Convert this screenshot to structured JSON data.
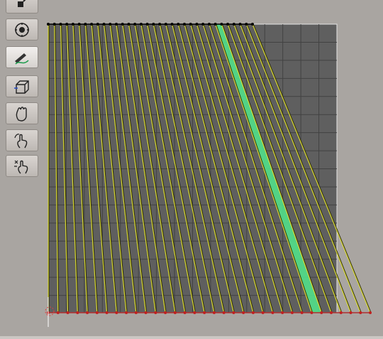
{
  "toolbar": {
    "tools": [
      {
        "icon": "viewport-toggle-icon",
        "active": false
      },
      {
        "icon": "navigation-wheel-icon",
        "active": false
      },
      {
        "icon": "draw-curve-icon",
        "active": true
      },
      {
        "icon": "box-select-icon",
        "active": false
      },
      {
        "icon": "pan-hand-icon",
        "active": false
      },
      {
        "icon": "rotate-hand-icon",
        "active": false
      },
      {
        "icon": "zoom-hand-icon",
        "active": false
      }
    ]
  },
  "scene": {
    "strip_count": 33,
    "highlighted_strip": 27,
    "colors": {
      "background": "#a9a5a1",
      "grid_fill": "#5f5f5f",
      "grid_line": "#424242",
      "grid_border": "#e6e6e6",
      "strip_line": "#d9d93a",
      "strip_dark": "#2b2b00",
      "highlight": "#52e08a",
      "top_vertex": "#000000",
      "bottom_vertex": "#c02020",
      "bottom_edge": "#b03030"
    }
  }
}
